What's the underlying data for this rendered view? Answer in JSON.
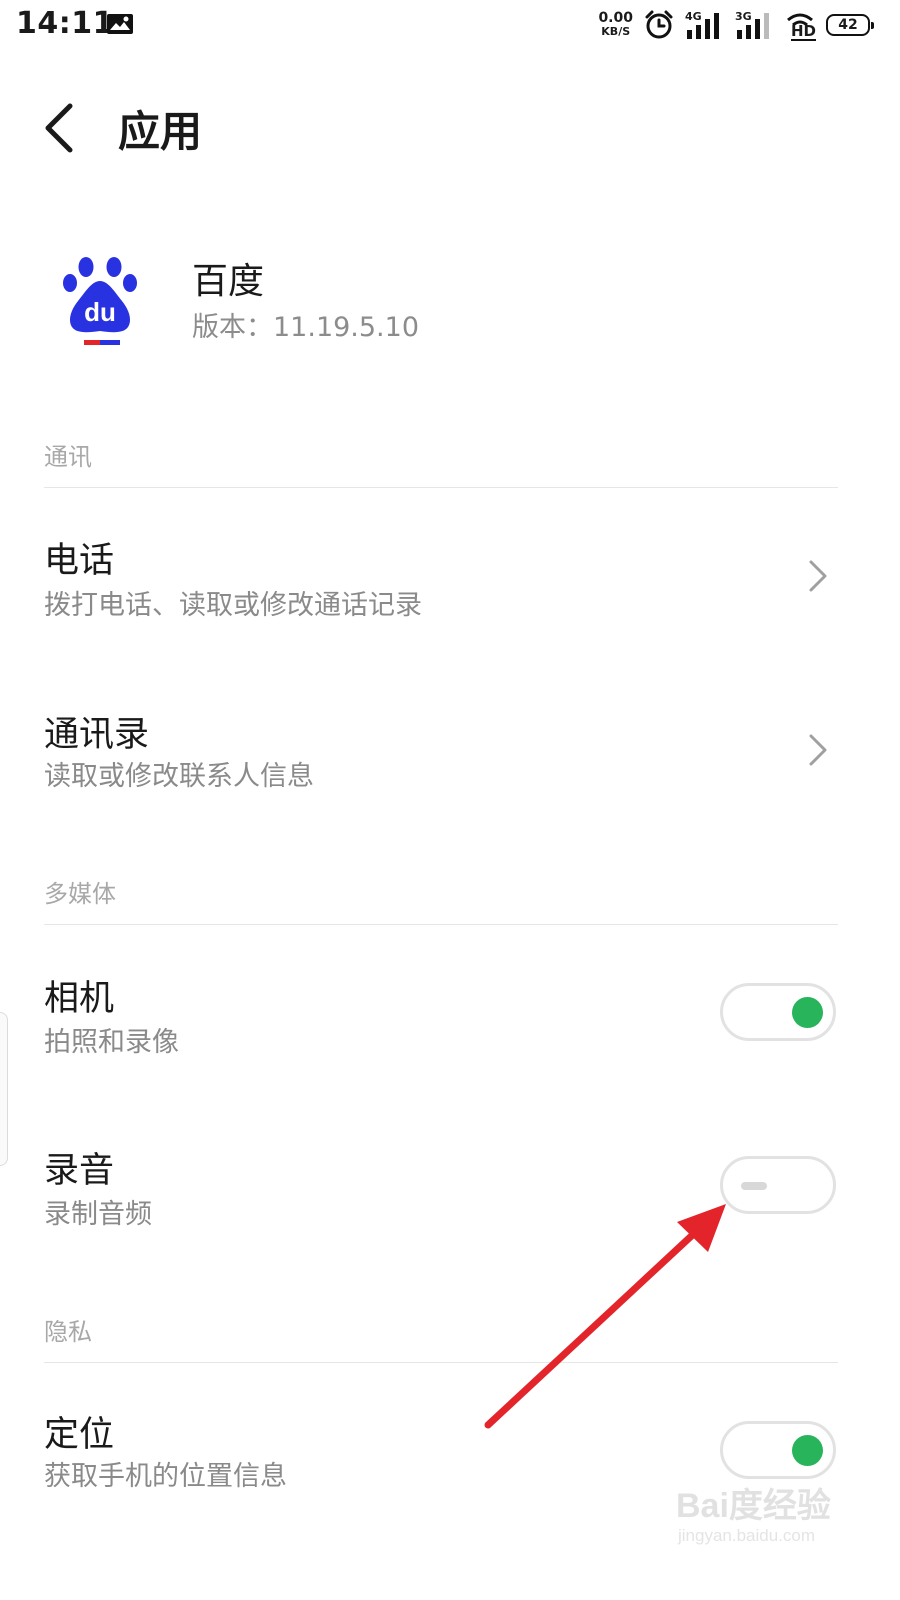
{
  "status_bar": {
    "time": "14:11",
    "net_speed_value": "0.00",
    "net_speed_unit": "KB/S",
    "signal1_tag": "4G",
    "signal2_tag": "3G",
    "hd_label": "HD",
    "battery": "42"
  },
  "header": {
    "title": "应用"
  },
  "app": {
    "name": "百度",
    "version": "版本：11.19.5.10",
    "logo_text": "du"
  },
  "sections": {
    "communication": "通讯",
    "multimedia": "多媒体",
    "privacy": "隐私"
  },
  "permissions": {
    "phone": {
      "title": "电话",
      "subtitle": "拨打电话、读取或修改通话记录"
    },
    "contacts": {
      "title": "通讯录",
      "subtitle": "读取或修改联系人信息"
    },
    "camera": {
      "title": "相机",
      "subtitle": "拍照和录像",
      "enabled": true
    },
    "microphone": {
      "title": "录音",
      "subtitle": "录制音频",
      "enabled": false
    },
    "location": {
      "title": "定位",
      "subtitle": "获取手机的位置信息",
      "enabled": true
    }
  },
  "watermark": {
    "main": "Bai度经验",
    "sub": "jingyan.baidu.com"
  },
  "colors": {
    "toggle_on": "#27b45a",
    "arrow": "#e3242b",
    "baidu_blue": "#2932e1"
  }
}
